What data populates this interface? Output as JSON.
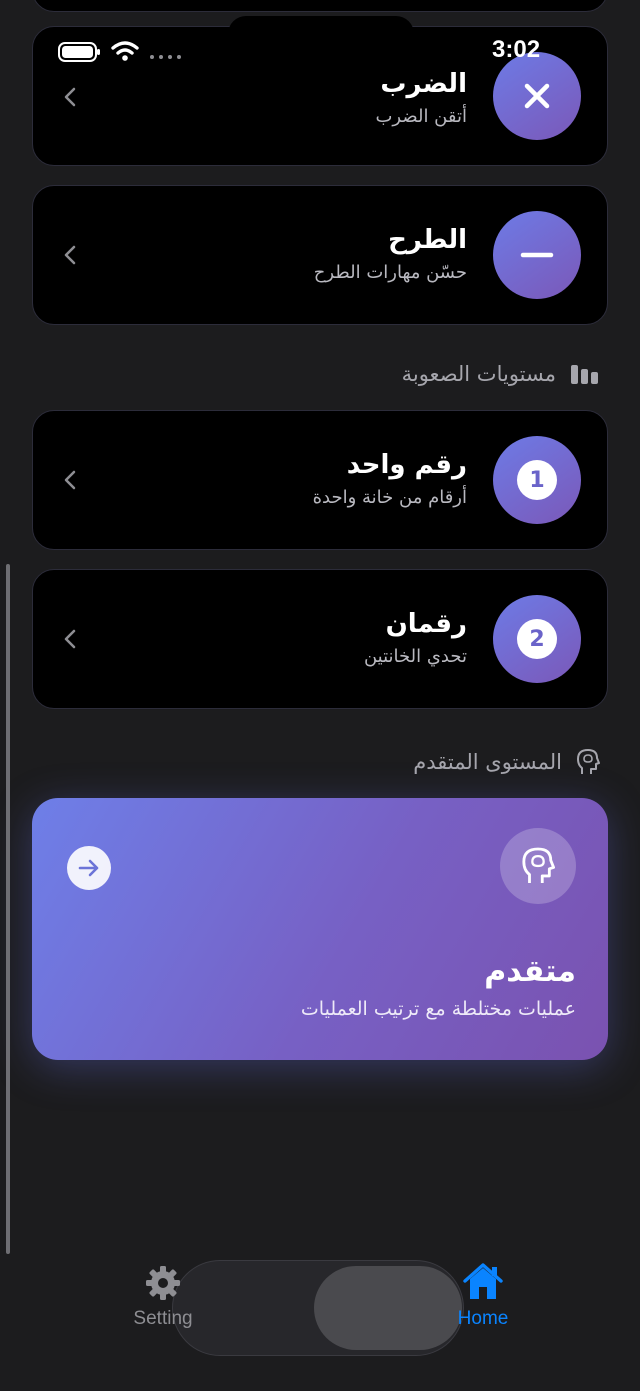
{
  "status_bar": {
    "time": "3:02"
  },
  "operations": [
    {
      "title": "الضرب",
      "subtitle": "أتقن الضرب",
      "icon": "multiply-icon"
    },
    {
      "title": "الطرح",
      "subtitle": "حسّن مهارات الطرح",
      "icon": "minus-icon"
    }
  ],
  "difficulty": {
    "header": "مستويات الصعوبة",
    "header_icon": "chart-bars-icon",
    "levels": [
      {
        "title": "رقم واحد",
        "subtitle": "أرقام من خانة واحدة",
        "badge": "1"
      },
      {
        "title": "رقمان",
        "subtitle": "تحدي الخانتين",
        "badge": "2"
      }
    ]
  },
  "advanced": {
    "header": "المستوى المتقدم",
    "header_icon": "brain-head-icon",
    "card_title": "متقدم",
    "card_subtitle": "عمليات مختلطة مع ترتيب العمليات"
  },
  "tabbar": {
    "setting_label": "Setting",
    "home_label": "Home",
    "active": "home"
  },
  "colors": {
    "accent_gradient_start": "#6d7be6",
    "accent_gradient_end": "#7b58b8",
    "tab_active": "#0a84ff",
    "tab_inactive": "#8e8e93"
  }
}
